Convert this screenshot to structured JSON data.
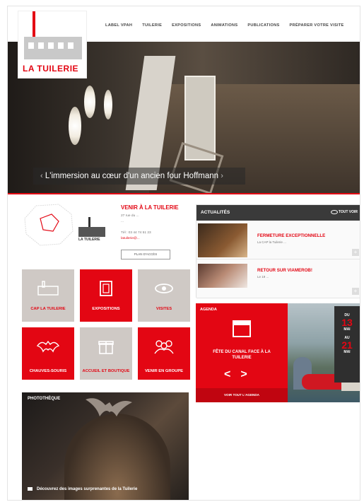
{
  "header": {
    "logo_text": "LA TUILERIE",
    "nav": [
      "LABEL VPAH",
      "TUILERIE",
      "EXPOSITIONS",
      "ANIMATIONS",
      "PUBLICATIONS",
      "PRÉPARER VOTRE VISITE"
    ]
  },
  "hero": {
    "caption": "L'immersion au cœur d'un ancien four Hoffmann",
    "prev": "‹",
    "next": "›"
  },
  "contact": {
    "title": "VENIR À LA TUILERIE",
    "addr1": "27 rue du ...",
    "addr2": "...",
    "tel": "Tél : 03 44 74 51 23",
    "email": "latuilerie@...",
    "button": "PLAN D'ACCÈS",
    "map_label": "LA TUILERIE"
  },
  "tiles": [
    {
      "label": "CAP LA TUILERIE",
      "style": "gray"
    },
    {
      "label": "EXPOSITIONS",
      "style": "red"
    },
    {
      "label": "VISITES",
      "style": "gray"
    },
    {
      "label": "CHAUVES-SOURIS",
      "style": "red"
    },
    {
      "label": "ACCUEIL ET BOUTIQUE",
      "style": "gray"
    },
    {
      "label": "VENIR EN GROUPE",
      "style": "red"
    }
  ],
  "photo": {
    "title": "PHOTOTHÈQUE",
    "caption": "Découvrez des images surprenantes de la Tuilerie"
  },
  "actualites": {
    "title": "ACTUALITÉS",
    "all": "TOUT VOIR",
    "items": [
      {
        "title": "FERMETURE EXCEPTIONNELLE",
        "desc": "La CAP la Tuilerie ..."
      },
      {
        "title": "RETOUR SUR VIAMEROB!",
        "desc": "Le 19 ..."
      }
    ]
  },
  "agenda": {
    "label": "AGENDA",
    "event": "FÊTE DU CANAL FACE À LA TUILERIE",
    "prev": "<",
    "next": ">",
    "footer": "VOIR TOUT L'AGENDA",
    "day1": "DU",
    "date1": "13",
    "month1": "MAI",
    "day2": "AU",
    "date2": "21",
    "month2": "MAI"
  },
  "colors": {
    "brand": "#e30613",
    "tile_gray": "#cfc9c5",
    "dark": "#3a3a3a"
  }
}
